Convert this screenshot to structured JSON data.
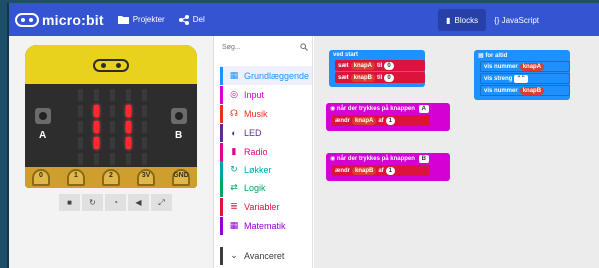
{
  "app": {
    "logo": "micro:bit"
  },
  "nav": {
    "projects": "Projekter",
    "share": "Del"
  },
  "editor": {
    "blocks": "Blocks",
    "javascript": "{} JavaScript"
  },
  "sim": {
    "button_a": "A",
    "button_b": "B",
    "pins": [
      "0",
      "1",
      "2",
      "3V",
      "GND"
    ],
    "leds": [
      [
        0,
        0,
        0,
        0,
        0
      ],
      [
        0,
        1,
        0,
        1,
        0
      ],
      [
        0,
        1,
        0,
        1,
        0
      ],
      [
        0,
        1,
        0,
        1,
        0
      ],
      [
        0,
        0,
        0,
        0,
        0
      ]
    ]
  },
  "toolbox": {
    "search_placeholder": "Søg...",
    "categories": [
      {
        "label": "Grundlæggende",
        "color": "#1e90ff",
        "icon": "grid"
      },
      {
        "label": "Input",
        "color": "#d400d4",
        "icon": "target"
      },
      {
        "label": "Musik",
        "color": "#e63022",
        "icon": "headphones"
      },
      {
        "label": "LED",
        "color": "#5c2d91",
        "icon": "toggle"
      },
      {
        "label": "Radio",
        "color": "#e3008c",
        "icon": "signal"
      },
      {
        "label": "Løkker",
        "color": "#00a4a6",
        "icon": "loop"
      },
      {
        "label": "Logik",
        "color": "#00a65c",
        "icon": "shuffle"
      },
      {
        "label": "Variabler",
        "color": "#dc143c",
        "icon": "list"
      },
      {
        "label": "Matematik",
        "color": "#9400d3",
        "icon": "calc"
      },
      {
        "label": "Avanceret",
        "color": "#3c3c3c",
        "icon": "chevron"
      }
    ]
  },
  "workspace": {
    "on_start": {
      "label": "ved start",
      "rows": [
        {
          "prefix": "sæt",
          "var": "knapA",
          "mid": "til",
          "value": "0"
        },
        {
          "prefix": "sæt",
          "var": "knapB",
          "mid": "til",
          "value": "0"
        }
      ]
    },
    "forever": {
      "label": "for altid",
      "rows": [
        {
          "prefix": "vis nummer",
          "var": "knapA"
        },
        {
          "prefix": "vis streng",
          "str": "\" \""
        },
        {
          "prefix": "vis nummer",
          "var": "knapB"
        }
      ]
    },
    "on_a": {
      "label": "når der trykkes på knappen",
      "button": "A",
      "row": {
        "prefix": "ændr",
        "var": "knapA",
        "mid": "af",
        "value": "1"
      }
    },
    "on_b": {
      "label": "når der trykkes på knappen",
      "button": "B",
      "row": {
        "prefix": "ændr",
        "var": "knapB",
        "mid": "af",
        "value": "1"
      }
    }
  }
}
